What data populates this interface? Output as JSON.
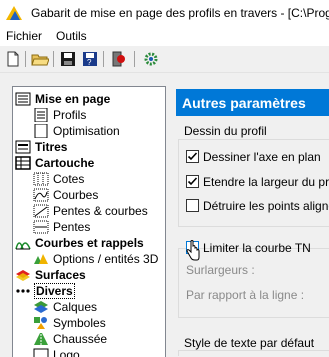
{
  "window": {
    "title": "Gabarit de mise en page des profils en travers - [C:\\Progra",
    "app_icon": "yellow-blue-app-icon"
  },
  "menu": {
    "items": [
      "Fichier",
      "Outils"
    ]
  },
  "toolbar": {
    "buttons": [
      "new-file-icon",
      "open-folder-icon",
      "save-icon",
      "save-as-icon",
      "exit-icon",
      "settings-gear-icon"
    ]
  },
  "tree": {
    "nodes": [
      {
        "label": "Mise en page",
        "bold": true,
        "level": 0,
        "icon": "page-layout-icon"
      },
      {
        "label": "Profils",
        "bold": false,
        "level": 1,
        "icon": "profile-icon"
      },
      {
        "label": "Optimisation",
        "bold": false,
        "level": 1,
        "icon": "blank-page-icon"
      },
      {
        "label": "Titres",
        "bold": true,
        "level": 0,
        "icon": "title-icon"
      },
      {
        "label": "Cartouche",
        "bold": true,
        "level": 0,
        "icon": "table-icon"
      },
      {
        "label": "Cotes",
        "bold": false,
        "level": 1,
        "icon": "dimension-grid-icon"
      },
      {
        "label": "Courbes",
        "bold": false,
        "level": 1,
        "icon": "curve-icon"
      },
      {
        "label": "Pentes & courbes",
        "bold": false,
        "level": 1,
        "icon": "slope-curve-icon"
      },
      {
        "label": "Pentes",
        "bold": false,
        "level": 1,
        "icon": "slope-icon"
      },
      {
        "label": "Courbes et rappels",
        "bold": true,
        "level": 0,
        "icon": "green-curves-icon"
      },
      {
        "label": "Options / entités 3D",
        "bold": false,
        "level": 1,
        "icon": "options-3d-icon"
      },
      {
        "label": "Surfaces",
        "bold": true,
        "level": 0,
        "icon": "surfaces-icon"
      },
      {
        "label": "Divers",
        "bold": true,
        "level": 0,
        "icon": "dots-icon",
        "selected": true
      },
      {
        "label": "Calques",
        "bold": false,
        "level": 1,
        "icon": "layers-icon"
      },
      {
        "label": "Symboles",
        "bold": false,
        "level": 1,
        "icon": "symbols-icon"
      },
      {
        "label": "Chaussée",
        "bold": false,
        "level": 1,
        "icon": "road-icon"
      },
      {
        "label": "Logo",
        "bold": false,
        "level": 1,
        "icon": "logo-icon"
      }
    ]
  },
  "panel": {
    "header": "Autres paramètres",
    "group1": {
      "title": "Dessin du profil",
      "options": [
        {
          "label": "Dessiner l'axe en plan",
          "checked": true
        },
        {
          "label": "Etendre la largeur du profil",
          "checked": true
        },
        {
          "label": "Détruire les points alignés",
          "checked": false
        }
      ]
    },
    "group2": {
      "option": {
        "label": "Limiter la courbe TN",
        "checked": false
      },
      "surlargeurs_label": "Surlargeurs :",
      "par_rapport_label": "Par rapport à la ligne :"
    },
    "group3_title": "Style de texte par défaut"
  },
  "colors": {
    "accent": "#0078d7",
    "header_text": "#ffffff"
  }
}
